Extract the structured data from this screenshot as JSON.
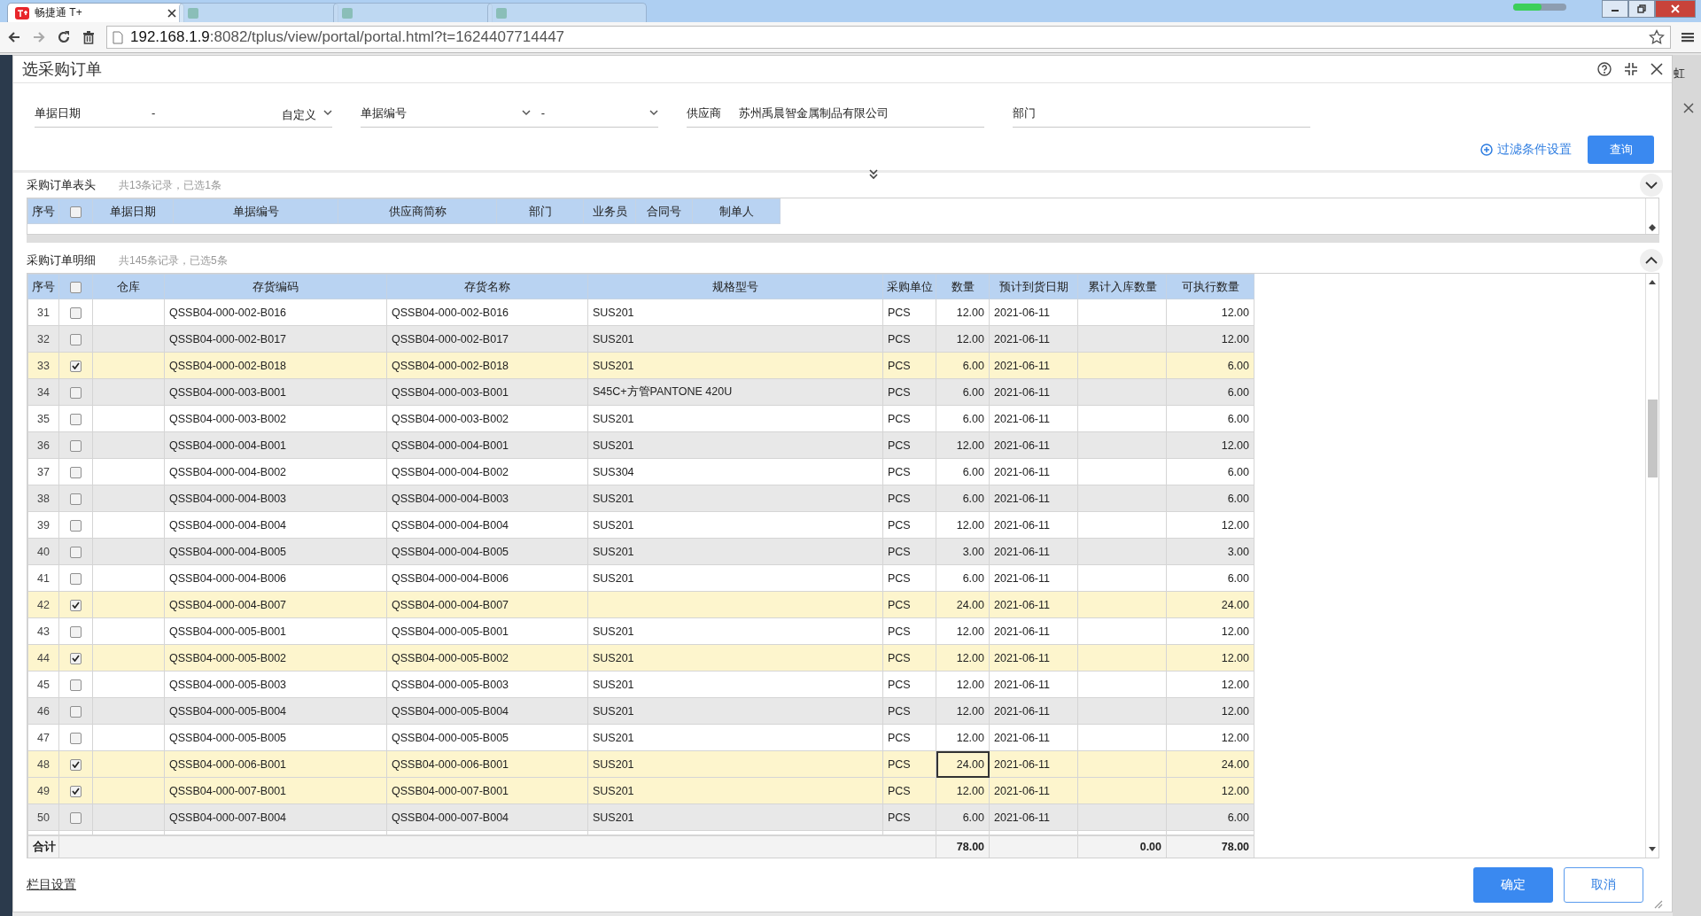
{
  "browser": {
    "tabs": [
      {
        "title": "畅捷通 T+",
        "selected": true
      },
      {
        "selected": false
      },
      {
        "selected": false
      },
      {
        "selected": false
      }
    ],
    "address": {
      "host": "192.168.1.9",
      "path": ":8082/tplus/view/portal/portal.html?t=1624407714447"
    }
  },
  "background_page": {
    "text": "虹"
  },
  "dialog": {
    "title": "选采购订单",
    "filters": [
      {
        "kind": "date_range",
        "label": "单据日期",
        "value": "-",
        "mode": "自定义"
      },
      {
        "kind": "code_range",
        "label": "单据编号",
        "value": "-"
      },
      {
        "kind": "text",
        "label": "供应商",
        "value": "苏州禹晨智金属制品有限公司"
      },
      {
        "kind": "text",
        "label": "部门"
      }
    ],
    "filter_settings": "过滤条件设置",
    "query_button": "查询",
    "header_section": {
      "title": "采购订单表头",
      "summary": "共13条记录，已选1条",
      "select_all": false,
      "expanded": false,
      "columns": [
        "序号",
        "单据日期",
        "单据编号",
        "供应商简称",
        "部门",
        "业务员",
        "合同号",
        "制单人"
      ]
    },
    "detail_section": {
      "title": "采购订单明细",
      "summary": "共145条记录，已选5条",
      "select_all": false,
      "expanded": true,
      "columns": [
        "序号",
        "仓库",
        "存货编码",
        "存货名称",
        "规格型号",
        "采购单位",
        "数量",
        "预计到货日期",
        "累计入库数量",
        "可执行数量"
      ],
      "rows": [
        {
          "no": "31",
          "checked": false,
          "focused": false,
          "code": "QSSB04-000-002-B016",
          "name": "QSSB04-000-002-B016",
          "spec": "SUS201",
          "unit": "PCS",
          "qty": "12.00",
          "date": "2021-06-11",
          "executable": "12.00"
        },
        {
          "no": "32",
          "checked": false,
          "focused": false,
          "code": "QSSB04-000-002-B017",
          "name": "QSSB04-000-002-B017",
          "spec": "SUS201",
          "unit": "PCS",
          "qty": "12.00",
          "date": "2021-06-11",
          "executable": "12.00"
        },
        {
          "no": "33",
          "checked": true,
          "focused": false,
          "code": "QSSB04-000-002-B018",
          "name": "QSSB04-000-002-B018",
          "spec": "SUS201",
          "unit": "PCS",
          "qty": "6.00",
          "date": "2021-06-11",
          "executable": "6.00"
        },
        {
          "no": "34",
          "checked": false,
          "focused": false,
          "code": "QSSB04-000-003-B001",
          "name": "QSSB04-000-003-B001",
          "spec": "S45C+方管PANTONE 420U",
          "unit": "PCS",
          "qty": "6.00",
          "date": "2021-06-11",
          "executable": "6.00"
        },
        {
          "no": "35",
          "checked": false,
          "focused": false,
          "code": "QSSB04-000-003-B002",
          "name": "QSSB04-000-003-B002",
          "spec": "SUS201",
          "unit": "PCS",
          "qty": "6.00",
          "date": "2021-06-11",
          "executable": "6.00"
        },
        {
          "no": "36",
          "checked": false,
          "focused": false,
          "code": "QSSB04-000-004-B001",
          "name": "QSSB04-000-004-B001",
          "spec": "SUS201",
          "unit": "PCS",
          "qty": "12.00",
          "date": "2021-06-11",
          "executable": "12.00"
        },
        {
          "no": "37",
          "checked": false,
          "focused": false,
          "code": "QSSB04-000-004-B002",
          "name": "QSSB04-000-004-B002",
          "spec": "SUS304",
          "unit": "PCS",
          "qty": "6.00",
          "date": "2021-06-11",
          "executable": "6.00"
        },
        {
          "no": "38",
          "checked": false,
          "focused": false,
          "code": "QSSB04-000-004-B003",
          "name": "QSSB04-000-004-B003",
          "spec": "SUS201",
          "unit": "PCS",
          "qty": "6.00",
          "date": "2021-06-11",
          "executable": "6.00"
        },
        {
          "no": "39",
          "checked": false,
          "focused": false,
          "code": "QSSB04-000-004-B004",
          "name": "QSSB04-000-004-B004",
          "spec": "SUS201",
          "unit": "PCS",
          "qty": "12.00",
          "date": "2021-06-11",
          "executable": "12.00"
        },
        {
          "no": "40",
          "checked": false,
          "focused": false,
          "code": "QSSB04-000-004-B005",
          "name": "QSSB04-000-004-B005",
          "spec": "SUS201",
          "unit": "PCS",
          "qty": "3.00",
          "date": "2021-06-11",
          "executable": "3.00"
        },
        {
          "no": "41",
          "checked": false,
          "focused": false,
          "code": "QSSB04-000-004-B006",
          "name": "QSSB04-000-004-B006",
          "spec": "SUS201",
          "unit": "PCS",
          "qty": "6.00",
          "date": "2021-06-11",
          "executable": "6.00"
        },
        {
          "no": "42",
          "checked": true,
          "focused": false,
          "code": "QSSB04-000-004-B007",
          "name": "QSSB04-000-004-B007",
          "unit": "PCS",
          "qty": "24.00",
          "date": "2021-06-11",
          "executable": "24.00"
        },
        {
          "no": "43",
          "checked": false,
          "focused": false,
          "code": "QSSB04-000-005-B001",
          "name": "QSSB04-000-005-B001",
          "spec": "SUS201",
          "unit": "PCS",
          "qty": "12.00",
          "date": "2021-06-11",
          "executable": "12.00"
        },
        {
          "no": "44",
          "checked": true,
          "focused": false,
          "code": "QSSB04-000-005-B002",
          "name": "QSSB04-000-005-B002",
          "spec": "SUS201",
          "unit": "PCS",
          "qty": "12.00",
          "date": "2021-06-11",
          "executable": "12.00"
        },
        {
          "no": "45",
          "checked": false,
          "focused": false,
          "code": "QSSB04-000-005-B003",
          "name": "QSSB04-000-005-B003",
          "spec": "SUS201",
          "unit": "PCS",
          "qty": "12.00",
          "date": "2021-06-11",
          "executable": "12.00"
        },
        {
          "no": "46",
          "checked": false,
          "focused": false,
          "code": "QSSB04-000-005-B004",
          "name": "QSSB04-000-005-B004",
          "spec": "SUS201",
          "unit": "PCS",
          "qty": "12.00",
          "date": "2021-06-11",
          "executable": "12.00"
        },
        {
          "no": "47",
          "checked": false,
          "focused": false,
          "code": "QSSB04-000-005-B005",
          "name": "QSSB04-000-005-B005",
          "spec": "SUS201",
          "unit": "PCS",
          "qty": "12.00",
          "date": "2021-06-11",
          "executable": "12.00"
        },
        {
          "no": "48",
          "checked": true,
          "focused": true,
          "code": "QSSB04-000-006-B001",
          "name": "QSSB04-000-006-B001",
          "spec": "SUS201",
          "unit": "PCS",
          "qty": "24.00",
          "date": "2021-06-11",
          "executable": "24.00"
        },
        {
          "no": "49",
          "checked": true,
          "focused": false,
          "code": "QSSB04-000-007-B001",
          "name": "QSSB04-000-007-B001",
          "spec": "SUS201",
          "unit": "PCS",
          "qty": "12.00",
          "date": "2021-06-11",
          "executable": "12.00"
        },
        {
          "no": "50",
          "checked": false,
          "focused": false,
          "code": "QSSB04-000-007-B004",
          "name": "QSSB04-000-007-B004",
          "spec": "SUS201",
          "unit": "PCS",
          "qty": "6.00",
          "date": "2021-06-11",
          "executable": "6.00"
        }
      ],
      "totals": {
        "label": "合计",
        "qty": "78.00",
        "received": "0.00",
        "executable": "78.00"
      }
    },
    "column_settings": "栏目设置",
    "buttons": [
      {
        "kind": "primary",
        "label": "确定"
      },
      {
        "kind": "secondary",
        "label": "取消"
      }
    ]
  }
}
